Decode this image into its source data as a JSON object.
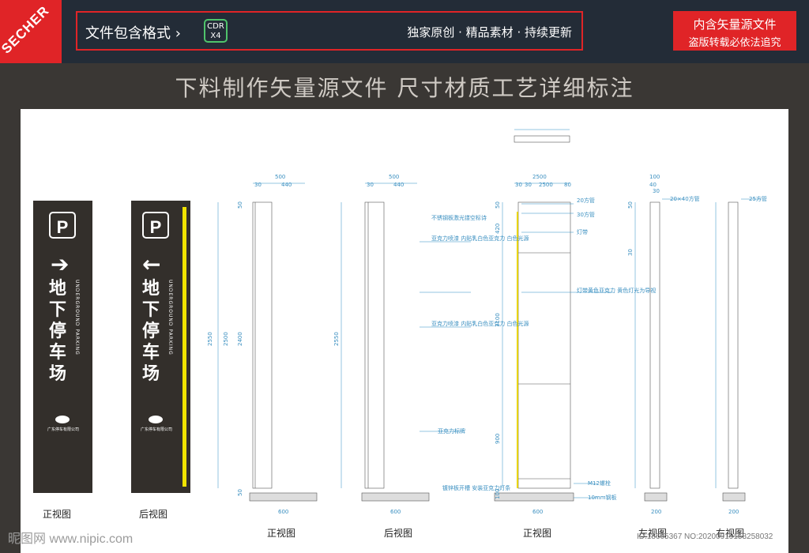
{
  "brand": "SECHER",
  "header": {
    "format_label": "文件包含格式 ›",
    "format_badge_line1": "CDR",
    "format_badge_line2": "X4",
    "slogan": "独家原创 · 精品素材 · 持续更新",
    "notice_line1": "内含矢量源文件",
    "notice_line2": "盗版转载必依法追究"
  },
  "headline": "下料制作矢量源文件  尺寸材质工艺详细标注",
  "signs": [
    {
      "parking_icon": "P",
      "arrow": "➔",
      "text": "地下停车场",
      "en": "UNDERGROUND PARKING",
      "logo_text": "广东停车有限公司",
      "caption": "正视图"
    },
    {
      "parking_icon": "P",
      "arrow": "←",
      "text": "地下停车场",
      "en": "UNDERGROUND PARKING",
      "logo_text": "广东停车有限公司",
      "caption": "后视图"
    }
  ],
  "drawings": {
    "captions": [
      "正视图",
      "后视图",
      "正视图",
      "左视图",
      "右视图"
    ],
    "top_dims": [
      "500",
      "30",
      "440",
      "500",
      "30",
      "440",
      "2500",
      "30",
      "30",
      "2500",
      "80",
      "100",
      "40",
      "30"
    ],
    "height_dims": [
      "2550",
      "2500",
      "2400",
      "2550",
      "50",
      "50",
      "100",
      "50",
      "1100",
      "900",
      "420",
      "50",
      "30"
    ],
    "base_dims": [
      "600",
      "600",
      "600",
      "200",
      "200"
    ],
    "annotations": [
      "不锈钢板激光镂空标诗",
      "亚克力喷漆 内贴乳白色亚克力 白色光源",
      "亚克力喷漆 内贴乳白色亚克力 白色光源",
      "亚克力标牌",
      "镀锌板开槽 安装亚克力灯条",
      "20方管",
      "30方管",
      "灯带",
      "灯带黄色亚克力 黄色灯光为导视",
      "M12螺栓",
      "10mm钢板",
      "20×40方管",
      "25方管"
    ]
  },
  "watermark": "昵图网 www.nipic.com",
  "watermark_id": "ID:18605367 NO:20200919153258032"
}
